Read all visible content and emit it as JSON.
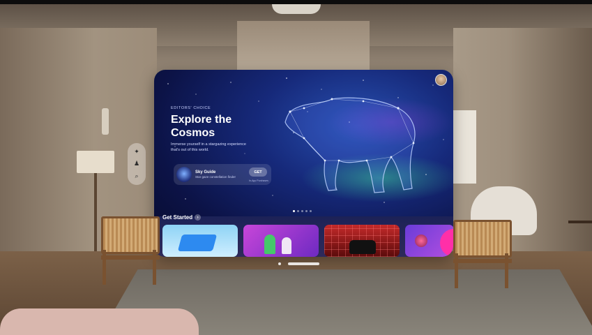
{
  "hero": {
    "eyebrow": "EDITORS' CHOICE",
    "title_line1": "Explore the",
    "title_line2": "Cosmos",
    "subtitle": "Immerse yourself in a stargazing experience that's out of this world."
  },
  "featured_app": {
    "name": "Sky Guide",
    "description": "Star gaze constellation finder",
    "get_label": "GET",
    "purchase_note": "In-App Purchases"
  },
  "carousel": {
    "page_count": 5,
    "active_index": 0
  },
  "section": {
    "title": "Get Started"
  },
  "ornament": {
    "items": [
      {
        "icon": "app-store-icon",
        "glyph": "✦"
      },
      {
        "icon": "arcade-icon",
        "glyph": "♟"
      },
      {
        "icon": "search-icon",
        "glyph": "⌕"
      }
    ]
  },
  "tiles": [
    {
      "icon": "puzzle-blocks-tile"
    },
    {
      "icon": "board-game-tile"
    },
    {
      "icon": "racing-car-tile"
    },
    {
      "icon": "orb-game-tile"
    }
  ],
  "colors": {
    "window_bg": "#0c1347",
    "accent_aurora": "#3cc896"
  }
}
